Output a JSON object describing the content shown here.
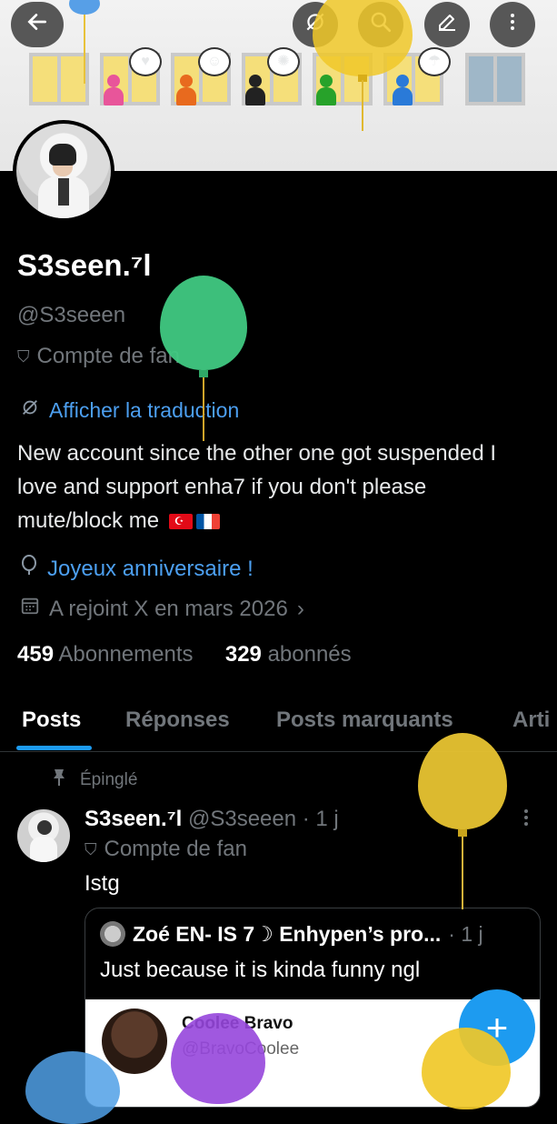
{
  "header": {
    "back_icon": "arrow-left-icon",
    "actions": [
      "translate-off-icon",
      "search-icon",
      "edit-icon",
      "more-vertical-icon"
    ]
  },
  "banner": {
    "bubbles": [
      "♥",
      "☺",
      "✺",
      "☂"
    ]
  },
  "profile": {
    "display_name": "S3seen.⁷l",
    "handle": "@S3seeen",
    "fan_label": "Compte de fan",
    "translate_link": "Afficher la traduction",
    "bio": "New account since the other one got suspended  I love and support enha7 if you don't please mute/block me",
    "birthday": "Joyeux anniversaire !",
    "joined": "A rejoint X en mars 2026",
    "following_count": "459",
    "following_label": "Abonnements",
    "followers_count": "329",
    "followers_label": "abonnés"
  },
  "tabs": [
    {
      "label": "Posts",
      "active": true
    },
    {
      "label": "Réponses",
      "active": false
    },
    {
      "label": "Posts marquants",
      "active": false
    },
    {
      "label": "Arti",
      "active": false
    }
  ],
  "post": {
    "pinned_label": "Épinglé",
    "author": "S3seen.⁷l",
    "meta": "@S3seeen · 1 j",
    "fan_label": "Compte de fan",
    "text": "Istg",
    "quote": {
      "author": "Zoé EN- IS 7☽ Enhypen’s pro...",
      "meta": "· 1 j",
      "text": "Just because it is kinda funny ngl",
      "media_name": "Coolee Bravo",
      "media_handle": "@BravoCoolee"
    }
  },
  "fab": {
    "label": "+"
  },
  "colors": {
    "accent": "#1d9bf0",
    "link": "#4c9ff0",
    "muted": "#71767b",
    "background": "#000000"
  }
}
